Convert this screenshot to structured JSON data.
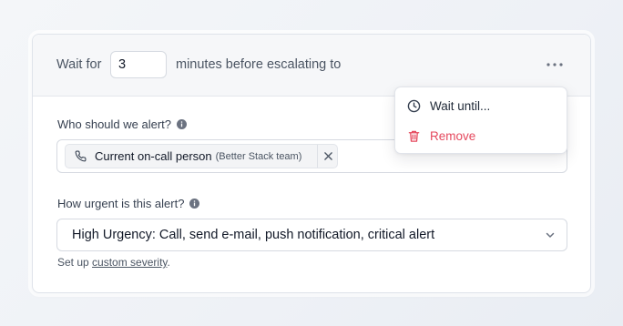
{
  "escalation": {
    "wait_prefix": "Wait for",
    "minutes_value": "3",
    "wait_suffix": "minutes before escalating to",
    "more_icon": "more-horizontal-icon"
  },
  "alert_target": {
    "label": "Who should we alert?",
    "tag_name": "Current on-call person",
    "tag_team": "(Better Stack team)"
  },
  "urgency": {
    "label": "How urgent is this alert?",
    "selected": "High Urgency: Call, send e-mail, push notification, critical alert"
  },
  "footer": {
    "setup_prefix": "Set up",
    "setup_link": "custom severity",
    "setup_suffix": "."
  },
  "menu": {
    "items": [
      {
        "label": "Wait until...",
        "icon": "clock-icon",
        "color": "#1f2937"
      },
      {
        "label": "Remove",
        "icon": "trash-icon",
        "color": "#e5485d"
      }
    ]
  },
  "colors": {
    "danger": "#e5485d",
    "muted_text": "#4b5563"
  }
}
